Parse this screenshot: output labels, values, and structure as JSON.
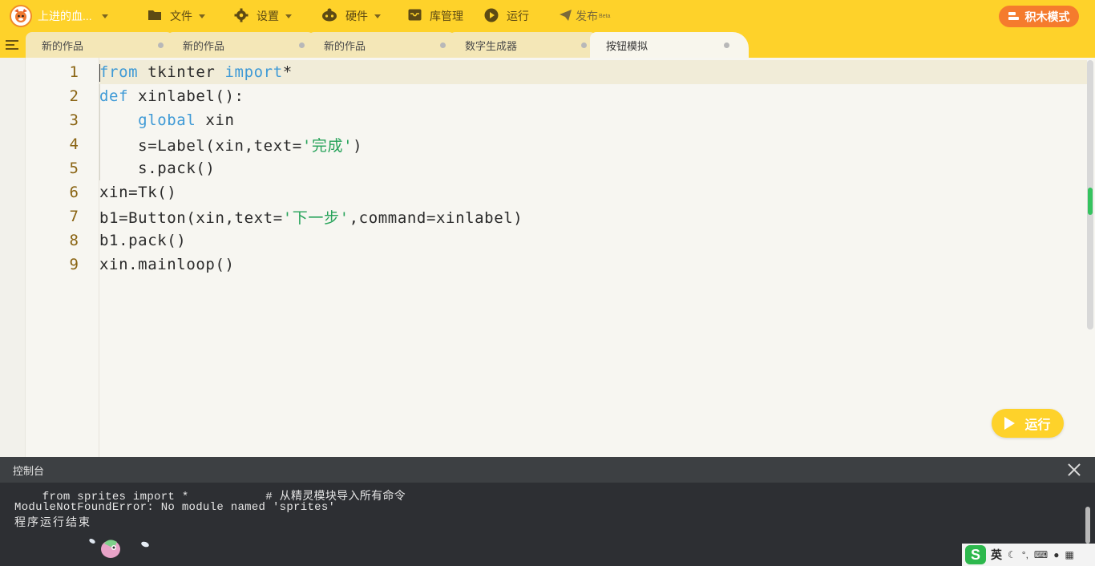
{
  "topbar": {
    "user_name": "上进的血...",
    "menu": [
      {
        "label": "文件",
        "icon": "folder-icon"
      },
      {
        "label": "设置",
        "icon": "gear-icon"
      },
      {
        "label": "硬件",
        "icon": "robot-icon"
      },
      {
        "label": "库管理",
        "icon": "inbox-icon"
      },
      {
        "label": "运行",
        "icon": "play-circle-icon"
      },
      {
        "label": "发布",
        "badge": "Beta",
        "icon": "paper-plane-icon"
      }
    ],
    "block_mode_label": "积木模式"
  },
  "tabs": [
    {
      "label": "新的作品",
      "active": false
    },
    {
      "label": "新的作品",
      "active": false
    },
    {
      "label": "新的作品",
      "active": false
    },
    {
      "label": "数字生成器",
      "active": false
    },
    {
      "label": "按钮模拟",
      "active": true
    }
  ],
  "editor": {
    "lines": [
      {
        "num": "1",
        "parts": [
          {
            "t": "from",
            "c": "kw"
          },
          {
            "t": " tkinter ",
            "c": ""
          },
          {
            "t": "import",
            "c": "kw"
          },
          {
            "t": "*",
            "c": ""
          }
        ]
      },
      {
        "num": "2",
        "parts": [
          {
            "t": "def",
            "c": "kw"
          },
          {
            "t": " xinlabel():",
            "c": ""
          }
        ]
      },
      {
        "num": "3",
        "parts": [
          {
            "t": "    ",
            "c": ""
          },
          {
            "t": "global",
            "c": "kw"
          },
          {
            "t": " xin",
            "c": ""
          }
        ]
      },
      {
        "num": "4",
        "parts": [
          {
            "t": "    s=Label(xin,text=",
            "c": ""
          },
          {
            "t": "'完成'",
            "c": "str"
          },
          {
            "t": ")",
            "c": ""
          }
        ]
      },
      {
        "num": "5",
        "parts": [
          {
            "t": "    s.pack()",
            "c": ""
          }
        ]
      },
      {
        "num": "6",
        "parts": [
          {
            "t": "xin=Tk()",
            "c": ""
          }
        ]
      },
      {
        "num": "7",
        "parts": [
          {
            "t": "b1=Button(xin,text=",
            "c": ""
          },
          {
            "t": "'下一步'",
            "c": "str"
          },
          {
            "t": ",command=xinlabel)",
            "c": ""
          }
        ]
      },
      {
        "num": "8",
        "parts": [
          {
            "t": "b1.pack()",
            "c": ""
          }
        ]
      },
      {
        "num": "9",
        "parts": [
          {
            "t": "xin.mainloop()",
            "c": ""
          }
        ]
      }
    ],
    "run_button_label": "运行"
  },
  "console": {
    "title": "控制台",
    "lines": [
      "    from sprites import *           # 从精灵模块导入所有命令",
      "ModuleNotFoundError: No module named 'sprites'",
      "程序运行结束"
    ]
  },
  "ime": {
    "logo": "S",
    "mode": "英"
  },
  "colors": {
    "accent": "#fed22a",
    "block_mode": "#f57b2d",
    "keyword": "#3f9ad6",
    "string": "#27a35a",
    "line_number": "#8a6413",
    "console_bg": "#2d2f33"
  }
}
